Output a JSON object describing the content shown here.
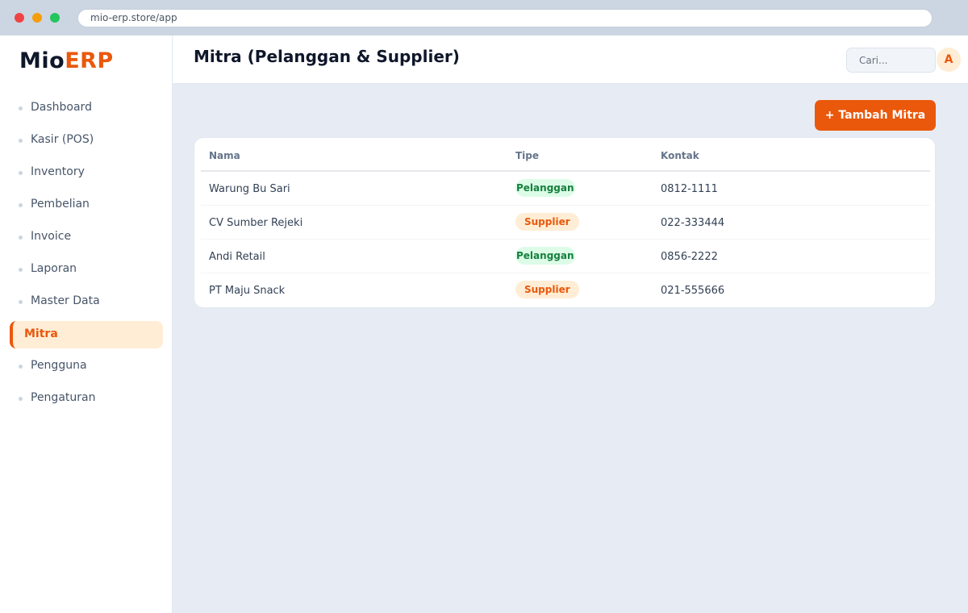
{
  "browser": {
    "url": "mio-erp.store/app"
  },
  "brand": {
    "name_part1": "Mio",
    "name_part2": "ERP",
    "accent_color": "#ea580c"
  },
  "sidebar": {
    "items": [
      {
        "label": "Dashboard",
        "active": false
      },
      {
        "label": "Kasir (POS)",
        "active": false
      },
      {
        "label": "Inventory",
        "active": false
      },
      {
        "label": "Pembelian",
        "active": false
      },
      {
        "label": "Invoice",
        "active": false
      },
      {
        "label": "Laporan",
        "active": false
      },
      {
        "label": "Master Data",
        "active": false
      },
      {
        "label": "Mitra",
        "active": true
      },
      {
        "label": "Pengguna",
        "active": false
      },
      {
        "label": "Pengaturan",
        "active": false
      }
    ]
  },
  "header": {
    "title": "Mitra (Pelanggan & Supplier)",
    "search_placeholder": "Cari...",
    "avatar_initial": "A"
  },
  "main": {
    "add_button_label": "+ Tambah Mitra",
    "table": {
      "columns": [
        "Nama",
        "Tipe",
        "Kontak"
      ],
      "rows": [
        {
          "nama": "Warung Bu Sari",
          "tipe": "Pelanggan",
          "kontak": "0812-1111"
        },
        {
          "nama": "CV Sumber Rejeki",
          "tipe": "Supplier",
          "kontak": "022-333444"
        },
        {
          "nama": "Andi Retail",
          "tipe": "Pelanggan",
          "kontak": "0856-2222"
        },
        {
          "nama": "PT Maju Snack",
          "tipe": "Supplier",
          "kontak": "021-555666"
        }
      ]
    }
  },
  "colors": {
    "pelanggan_badge_bg": "#dcfce7",
    "pelanggan_badge_text": "#15803d",
    "supplier_badge_bg": "#ffedd5",
    "supplier_badge_text": "#ea580c"
  }
}
